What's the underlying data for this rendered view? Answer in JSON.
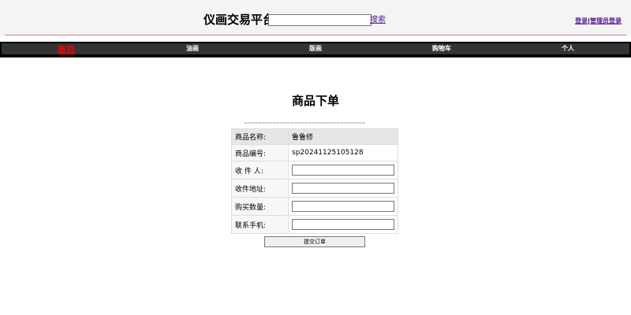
{
  "header": {
    "site_title": "仪画交易平台",
    "search_value": "",
    "search_link": "搜索",
    "login_link": "登录",
    "separator": "|",
    "admin_login_link": "管理员登录"
  },
  "nav": {
    "items": [
      {
        "label": "首页",
        "active": true
      },
      {
        "label": "油画"
      },
      {
        "label": "版画"
      },
      {
        "label": "购物车"
      },
      {
        "label": "个人"
      }
    ]
  },
  "main": {
    "title": "商品下单",
    "divider": "==================================",
    "rows": [
      {
        "label": "商品名称:",
        "value": "鲁鲁修"
      },
      {
        "label": "商品编号:",
        "value": "sp20241125105128"
      },
      {
        "label": "收 件 人:",
        "input_value": ""
      },
      {
        "label": "收件地址:",
        "input_value": ""
      },
      {
        "label": "购买数量:",
        "input_value": ""
      },
      {
        "label": "联系手机:",
        "input_value": ""
      }
    ],
    "submit_label": "提交订单"
  },
  "colors": {
    "nav_bg": "#333333",
    "nav_active": "#ff0000",
    "link": "#551a8b",
    "header_line": "#c98a8a"
  }
}
